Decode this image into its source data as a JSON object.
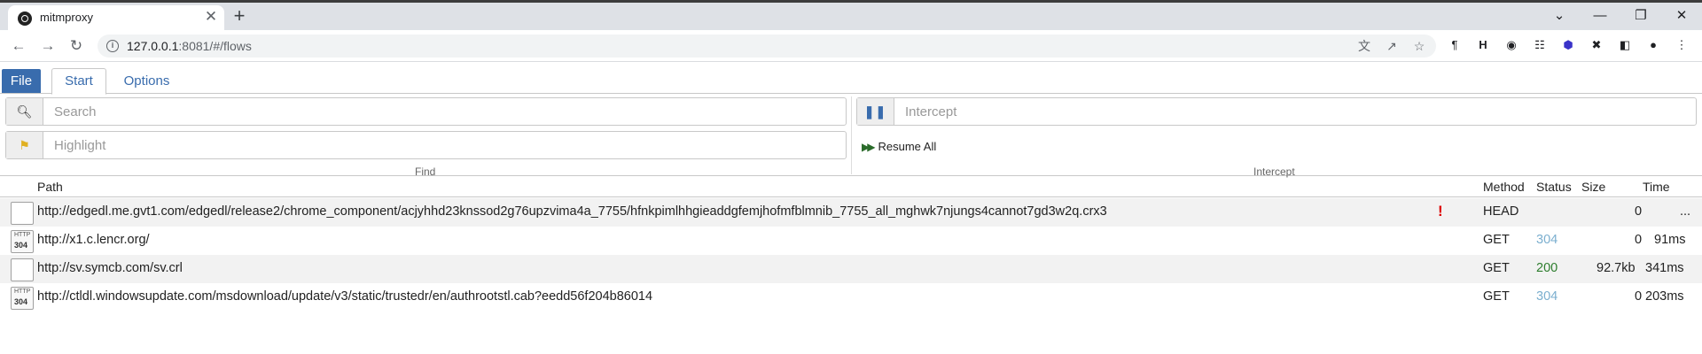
{
  "browser": {
    "tab_title": "mitmproxy",
    "tab_close": "✕",
    "new_tab": "+",
    "url_host": "127.0.0.1",
    "url_rest": ":8081/#/flows",
    "window_controls": {
      "chevron": "⌄",
      "minimize": "—",
      "maximize": "❐",
      "close": "✕"
    }
  },
  "menu": {
    "file": "File",
    "start": "Start",
    "options": "Options"
  },
  "find": {
    "search_placeholder": "Search",
    "highlight_placeholder": "Highlight",
    "group_label": "Find"
  },
  "intercept": {
    "intercept_placeholder": "Intercept",
    "resume_all": "Resume All",
    "group_label": "Intercept"
  },
  "table": {
    "headers": {
      "path": "Path",
      "method": "Method",
      "status": "Status",
      "size": "Size",
      "time": "Time"
    },
    "rows": [
      {
        "icon": "",
        "icon_sub": "",
        "path": "http://edgedl.me.gvt1.com/edgedl/release2/chrome_component/acjyhhd23knssod2g76upzvima4a_7755/hfnkpimlhhgieaddgfemjhofmfblmnib_7755_all_mghwk7njungs4cannot7gd3w2q.crx3",
        "error": "!",
        "method": "HEAD",
        "status": "",
        "size": "0",
        "time": "..."
      },
      {
        "icon": "HTTP",
        "icon_sub": "304",
        "path": "http://x1.c.lencr.org/",
        "error": "",
        "method": "GET",
        "status": "304",
        "size": "0",
        "time": "91ms"
      },
      {
        "icon": "",
        "icon_sub": "",
        "path": "http://sv.symcb.com/sv.crl",
        "error": "",
        "method": "GET",
        "status": "200",
        "size": "92.7kb",
        "time": "341ms"
      },
      {
        "icon": "HTTP",
        "icon_sub": "304",
        "path": "http://ctldl.windowsupdate.com/msdownload/update/v3/static/trustedr/en/authrootstl.cab?eedd56f204b86014",
        "error": "",
        "method": "GET",
        "status": "304",
        "size": "0",
        "time": "203ms"
      }
    ]
  },
  "colors": {
    "accent": "#396cad",
    "status_304": "#7bafcf",
    "status_200": "#2d7d2d",
    "error": "#dd0000"
  }
}
